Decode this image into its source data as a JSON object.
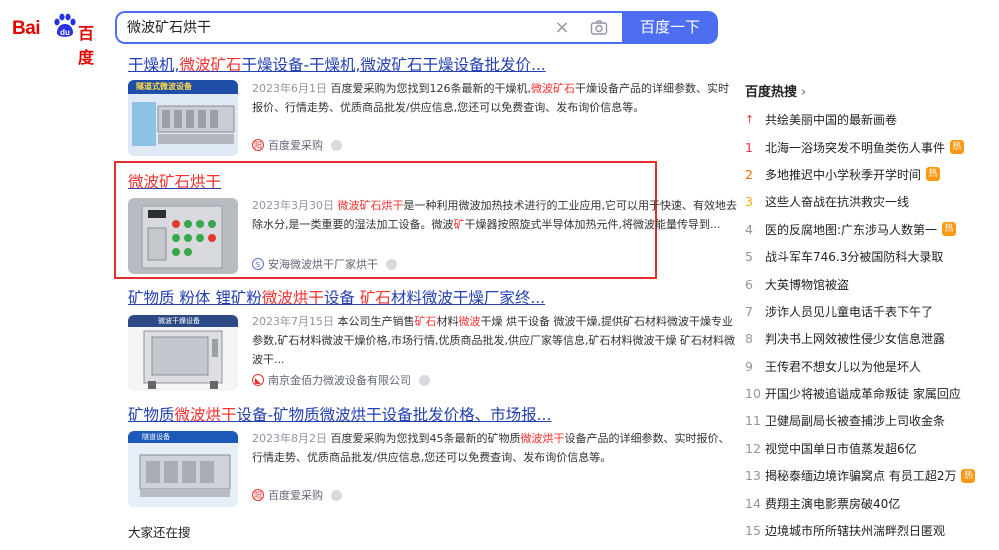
{
  "logo": {
    "text_left": "Bai",
    "text_right": "百度"
  },
  "search": {
    "query": "微波矿石烘干",
    "button_label": "百度一下"
  },
  "results": [
    {
      "title_parts": [
        "干燥机,",
        "微波矿石",
        "干燥设备-干燥机,微波矿石干燥设备批发价..."
      ],
      "date": "2023年6月1日",
      "snippet": [
        " 百度爱采购为您找到126条最新的干燥机,",
        "微波矿石",
        "干燥设备产品的详细参数、实时报价、行情走势、优质商品批发/供应信息,您还可以免费查询、发布询价信息等。"
      ],
      "source": "百度爱采购",
      "thumb_label": "隧道式微波设备"
    },
    {
      "title_parts": [
        "",
        "微波矿石烘干",
        ""
      ],
      "date": "2023年3月30日",
      "snippet": [
        " ",
        "微波矿石烘干",
        "是一种利用微波加热技术进行的工业应用,它可以用于快速、有效地去除水分,是一类重要的湿法加工设备。微波",
        "矿",
        "干燥器按照旋式半导体加热元件,将微波能量传导到..."
      ],
      "source": "安海微波烘干厂家烘干"
    },
    {
      "title_parts": [
        "矿物质 粉体 锂矿粉",
        "微波烘干",
        "设备 ",
        "矿石",
        "材料微波干燥厂家终..."
      ],
      "date": "2023年7月15日",
      "snippet": [
        " 本公司生产销售",
        "矿石",
        "材料",
        "微波",
        "干燥 烘干设备 微波干燥,提供矿石材料微波干燥专业参数,矿石材料微波干燥价格,市场行情,优质商品批发,供应厂家等信息,矿石材料微波干燥 矿石材料微波干..."
      ],
      "source": "南京金佰力微波设备有限公司",
      "thumb_label": "微波干燥设备"
    },
    {
      "title_parts": [
        "矿物质",
        "微波烘干",
        "设备-矿物质微波烘干设备批发价格、市场报..."
      ],
      "date": "2023年8月2日",
      "snippet": [
        " 百度爱采购为您找到45条最新的矿物质",
        "微波烘干",
        "设备产品的详细参数、实时报价、行情走势、优质商品批发/供应信息,您还可以免费查询、发布询价信息等。"
      ],
      "source": "百度爱采购",
      "thumb_label": "隧道设备"
    }
  ],
  "also_search": "大家还在搜",
  "hot": {
    "title": "百度热搜",
    "items": [
      {
        "rank": "↑",
        "text": "共绘美丽中国的最新画卷",
        "badge": ""
      },
      {
        "rank": "1",
        "text": "北海一浴场突发不明鱼类伤人事件",
        "badge": "热"
      },
      {
        "rank": "2",
        "text": "多地推迟中小学秋季开学时间",
        "badge": "热"
      },
      {
        "rank": "3",
        "text": "这些人奋战在抗洪救灾一线",
        "badge": ""
      },
      {
        "rank": "4",
        "text": "医的反腐地图:广东涉马人数第一",
        "badge": "热"
      },
      {
        "rank": "5",
        "text": "战斗军车746.3分被国防科大录取",
        "badge": ""
      },
      {
        "rank": "6",
        "text": "大英博物馆被盗",
        "badge": ""
      },
      {
        "rank": "7",
        "text": "涉诈人员见儿童电话千表下午了",
        "badge": ""
      },
      {
        "rank": "8",
        "text": "判决书上网效被性侵少女信息泄露",
        "badge": ""
      },
      {
        "rank": "9",
        "text": "王传君不想女儿以为他是坏人",
        "badge": ""
      },
      {
        "rank": "10",
        "text": "开国少将被追谥成革命叛徒 家属回应",
        "badge": ""
      },
      {
        "rank": "11",
        "text": "卫健局副局长被查捕涉上司收金条",
        "badge": ""
      },
      {
        "rank": "12",
        "text": "视觉中国单日市值蒸发超6亿",
        "badge": ""
      },
      {
        "rank": "13",
        "text": "揭秘泰缅边境诈骗窝点 有员工超2万",
        "badge": "热"
      },
      {
        "rank": "14",
        "text": "费翔主演电影票房破40亿",
        "badge": ""
      },
      {
        "rank": "15",
        "text": "边境城市所所辖扶州湍畔烈日匿观",
        "badge": ""
      }
    ]
  }
}
